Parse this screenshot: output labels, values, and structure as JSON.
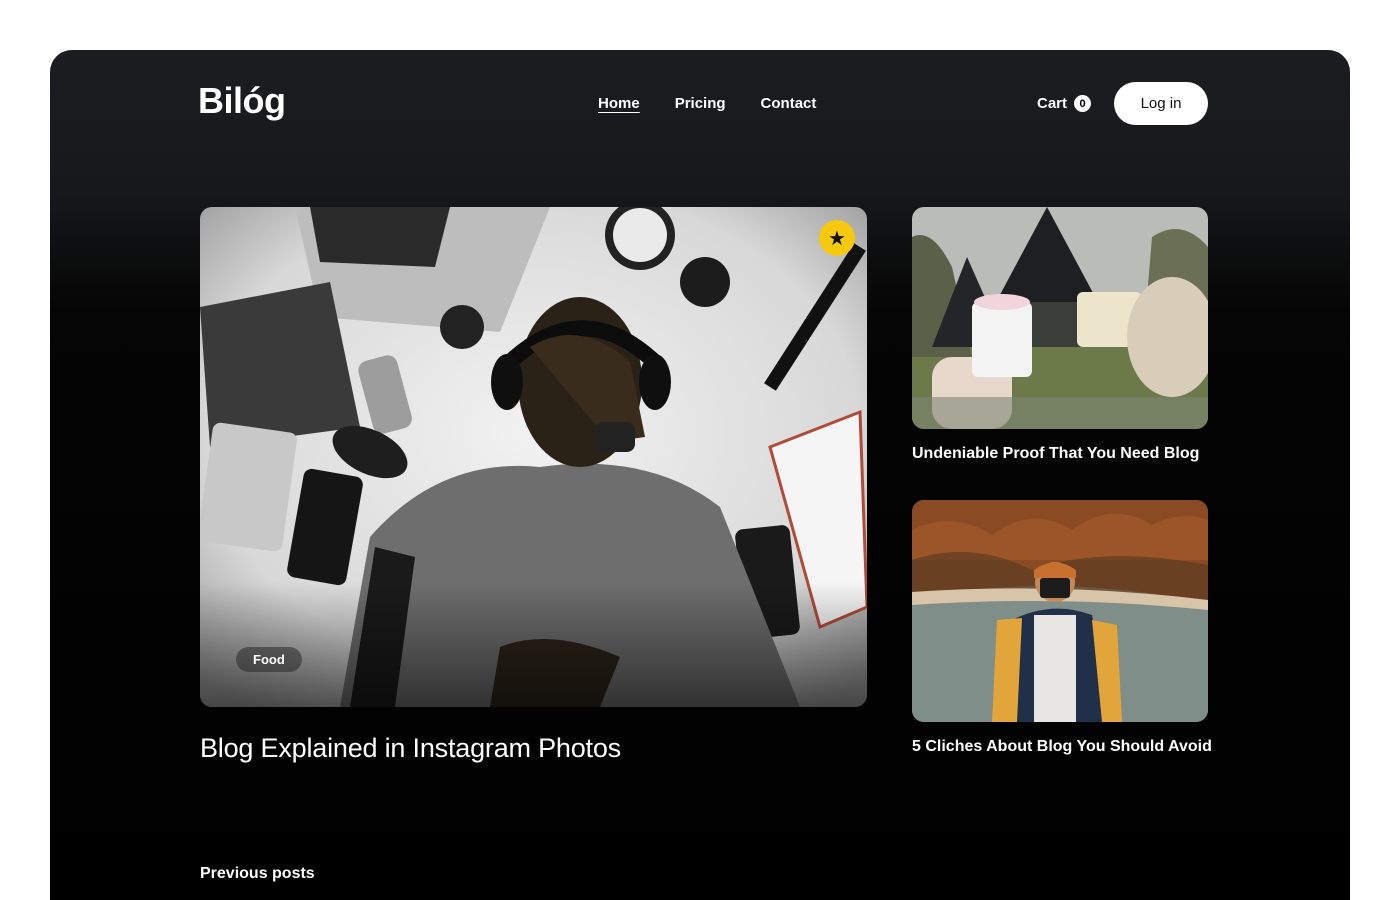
{
  "header": {
    "logo": "Bilóg",
    "nav": [
      {
        "label": "Home",
        "active": true
      },
      {
        "label": "Pricing",
        "active": false
      },
      {
        "label": "Contact",
        "active": false
      }
    ],
    "cart_label": "Cart",
    "cart_count": "0",
    "login_label": "Log in"
  },
  "featured": {
    "title": "Blog Explained in Instagram Photos",
    "category": "Food",
    "badge_icon": "star-icon"
  },
  "side_posts": [
    {
      "title": "Undeniable Proof That You Need Blog"
    },
    {
      "title": "5 Cliches About Blog You Should Avoid"
    }
  ],
  "section_title": "Previous posts",
  "colors": {
    "background": "#000000",
    "accent_badge": "#f6c90e",
    "text": "#ffffff"
  }
}
